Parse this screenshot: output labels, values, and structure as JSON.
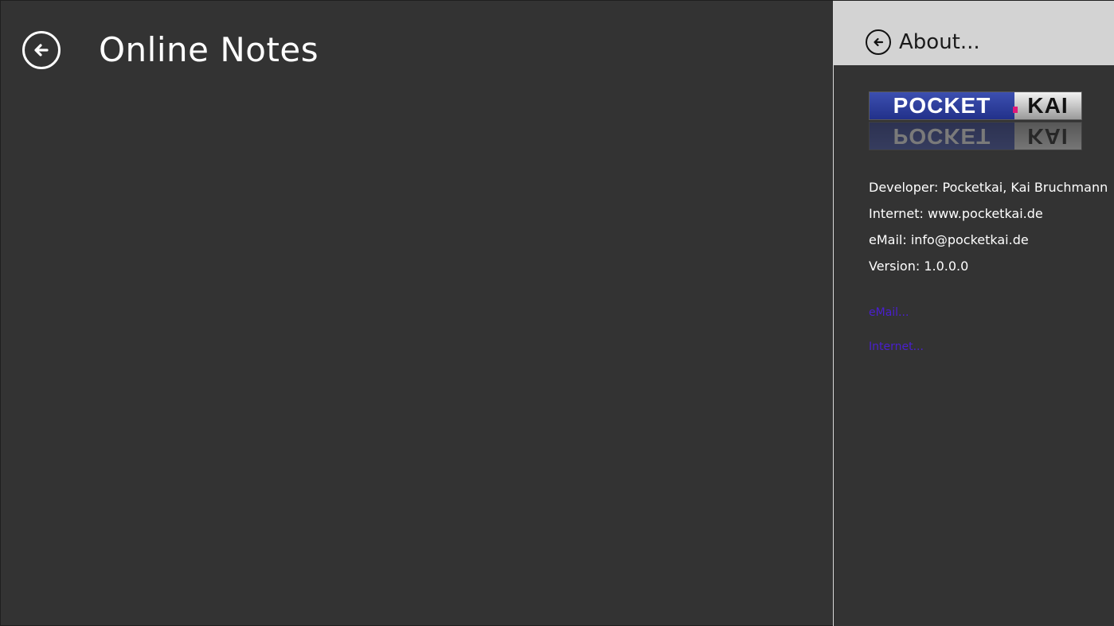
{
  "page": {
    "title": "Online Notes"
  },
  "flyout": {
    "title": "About...",
    "logo": {
      "left_text": "POCKET",
      "right_text": "KAI"
    },
    "info": {
      "developer": "Developer: Pocketkai, Kai Bruchmann",
      "internet": "Internet: www.pocketkai.de",
      "email": "eMail: info@pocketkai.de",
      "version": "Version: 1.0.0.0"
    },
    "links": {
      "email": "eMail...",
      "internet": "Internet..."
    }
  },
  "colors": {
    "background": "#333333",
    "flyout_header": "#d3d3d3",
    "link": "#4a1fd0",
    "logo_blue": "#2a3aa0"
  },
  "icons": {
    "main_back": "back-arrow-icon",
    "flyout_back": "back-arrow-icon"
  }
}
